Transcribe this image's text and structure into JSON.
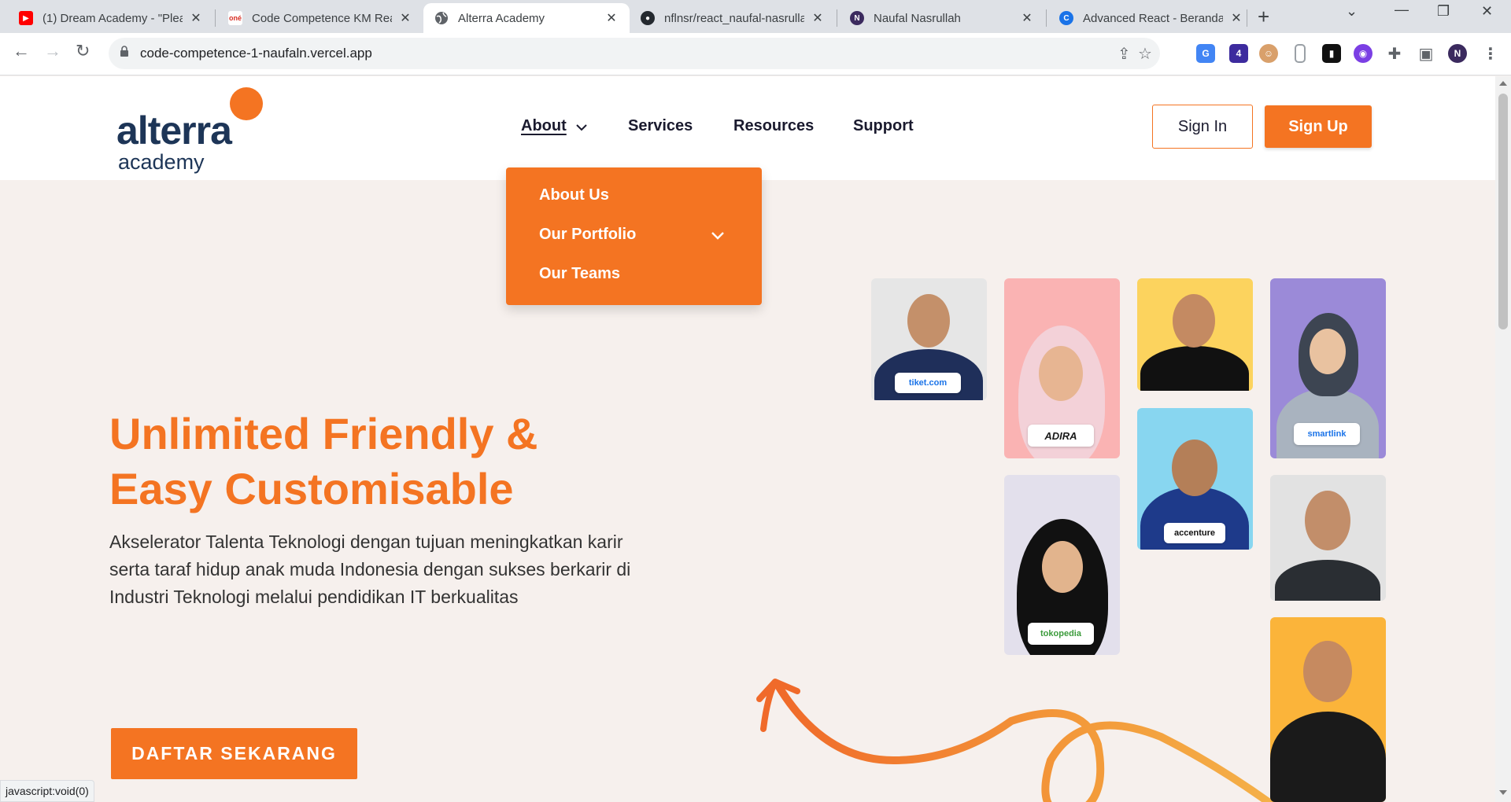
{
  "browser": {
    "tabs": [
      {
        "title": "(1) Dream Academy - \"Plea",
        "favicon": "youtube-icon",
        "color": "#ff0000"
      },
      {
        "title": "Code Competence KM Rea",
        "favicon": "one-icon",
        "color": "#ffffff"
      },
      {
        "title": "Alterra Academy",
        "favicon": "globe-icon",
        "color": "#5f6368"
      },
      {
        "title": "nflnsr/react_naufal-nasrulla",
        "favicon": "github-icon",
        "color": "#24292f"
      },
      {
        "title": "Naufal Nasrullah",
        "favicon": "n-icon",
        "color": "#3b2a5e"
      },
      {
        "title": "Advanced React - Beranda",
        "favicon": "c-icon",
        "color": "#1a73e8"
      }
    ],
    "url": "code-competence-1-naufaln.vercel.app",
    "status": "javascript:void(0)"
  },
  "site": {
    "logo": {
      "line1": "alterra",
      "line2": "academy"
    },
    "nav": {
      "about": "About",
      "services": "Services",
      "resources": "Resources",
      "support": "Support"
    },
    "signin": "Sign In",
    "signup": "Sign Up",
    "dropdown": {
      "about_us": "About Us",
      "portfolio": "Our Portfolio",
      "teams": "Our Teams"
    },
    "hero": {
      "title_line1": "Unlimited Friendly &",
      "title_line2": "Easy Customisable",
      "description": "Akselerator Talenta Teknologi dengan tujuan meningkatkan karir serta taraf hidup anak muda Indonesia dengan sukses berkarir di Industri Teknologi melalui pendidikan IT berkualitas",
      "cta": "DAFTAR SEKARANG"
    },
    "badges": {
      "tiket": "tiket.com",
      "adira": "ADIRA",
      "smartlink": "smartlink",
      "accenture": "accenture",
      "tokopedia": "tokopedia"
    }
  },
  "colors": {
    "accent": "#f47422",
    "navy": "#1d3557"
  }
}
